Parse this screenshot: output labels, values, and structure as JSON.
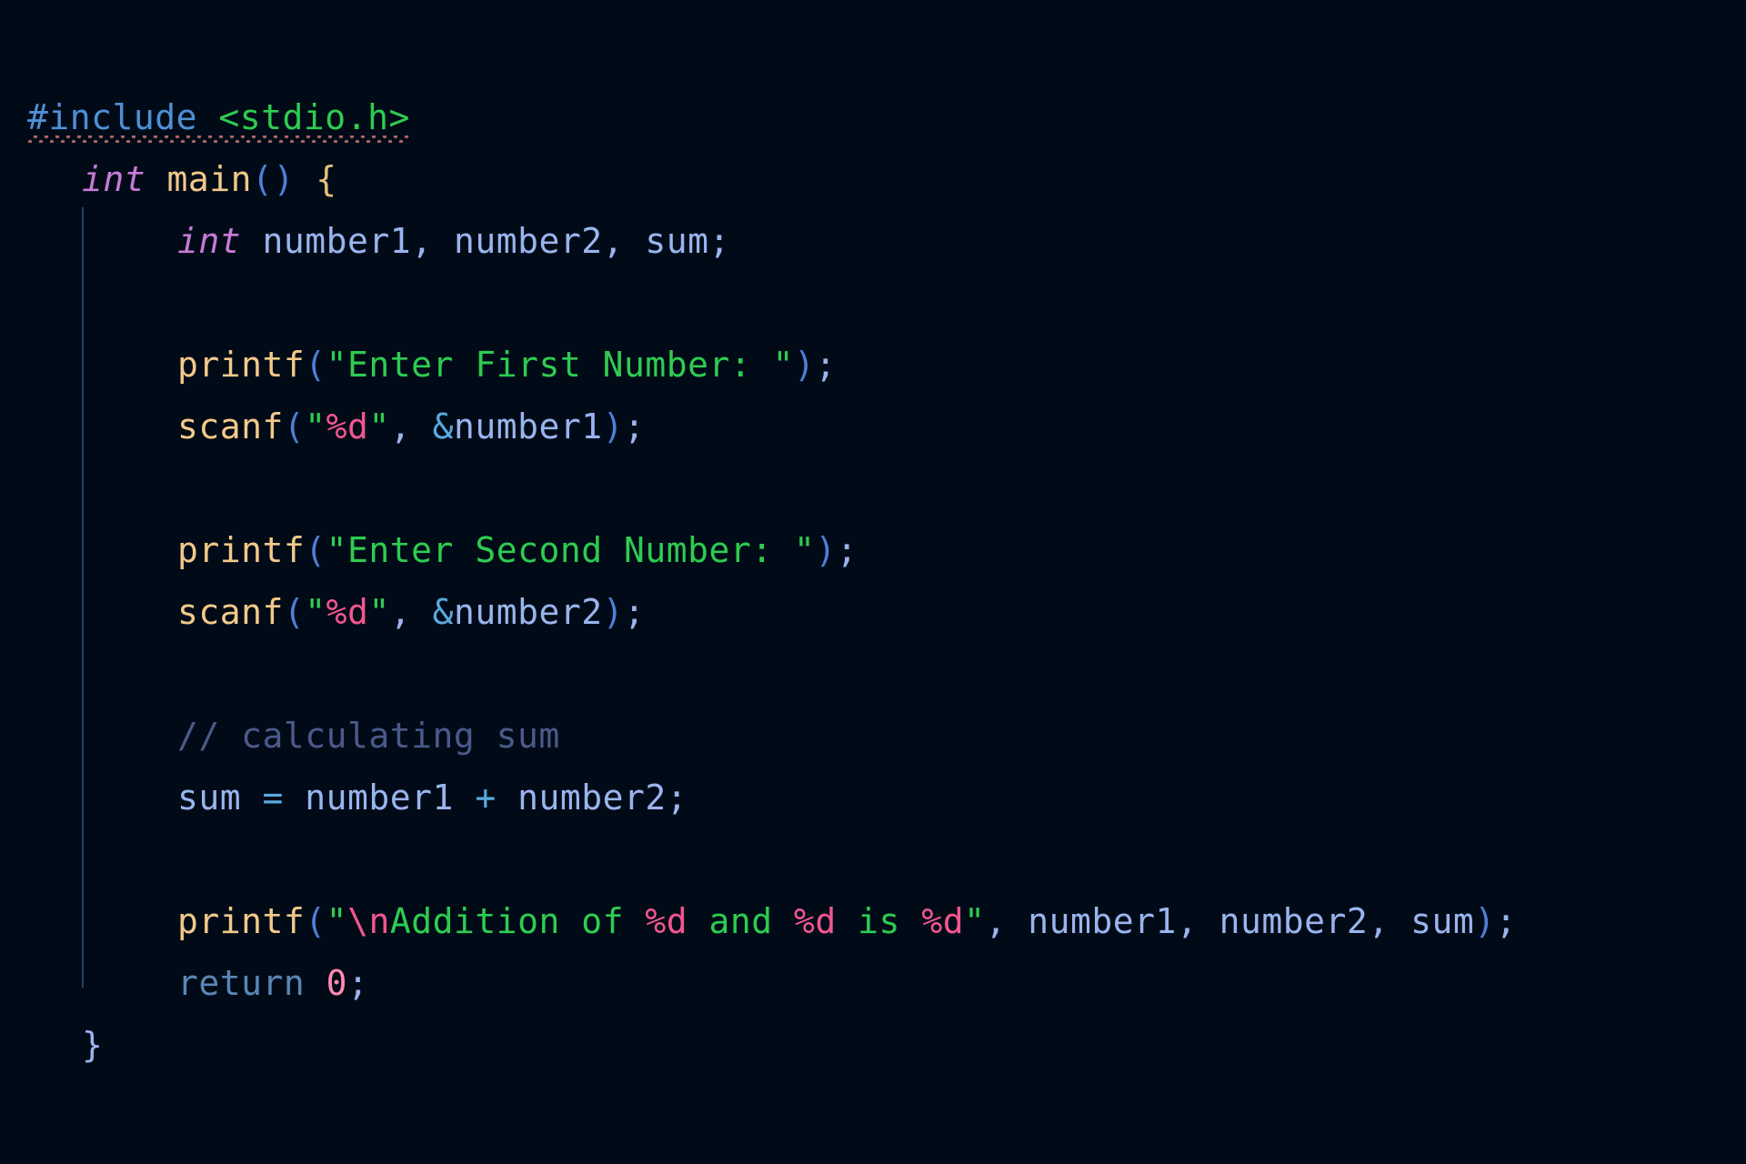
{
  "editor": {
    "language": "c",
    "background_color": "#010b18",
    "font_size_px": 38,
    "indent_guide_color": "#2b4a74",
    "squiggle_color": "#b36a6a"
  },
  "theme_colors": {
    "preprocessor": "#4f8fd6",
    "header_path": "#2ecc50",
    "type_keyword": "#c77ad6",
    "function": "#f2c98a",
    "paren": "#4f7fd6",
    "brace_open": "#e6c07b",
    "brace_close": "#9ab4ee",
    "variable": "#9ab4ee",
    "punctuation": "#9ab4ee",
    "string": "#2ecc50",
    "format_specifier": "#f2568f",
    "comment": "#4a5a8a",
    "operator": "#5aa9e0",
    "keyword": "#5a86b5",
    "number": "#ff8ab0"
  },
  "code": {
    "line1": {
      "preproc": "#include",
      "space": " ",
      "header": "<stdio.h>"
    },
    "line2": {
      "type": "int",
      "space": " ",
      "func": "main",
      "paren_open": "(",
      "paren_close": ")",
      "space2": " ",
      "brace": "{"
    },
    "line3": {
      "type": "int",
      "space": " ",
      "var1": "number1",
      "comma1": ", ",
      "var2": "number2",
      "comma2": ", ",
      "var3": "sum",
      "semi": ";"
    },
    "line5": {
      "func": "printf",
      "paren_open": "(",
      "string": "\"Enter First Number: \"",
      "paren_close": ")",
      "semi": ";"
    },
    "line6": {
      "func": "scanf",
      "paren_open": "(",
      "quote_open": "\"",
      "fmt": "%d",
      "quote_close": "\"",
      "comma": ", ",
      "amp": "&",
      "var": "number1",
      "paren_close": ")",
      "semi": ";"
    },
    "line8": {
      "func": "printf",
      "paren_open": "(",
      "string": "\"Enter Second Number: \"",
      "paren_close": ")",
      "semi": ";"
    },
    "line9": {
      "func": "scanf",
      "paren_open": "(",
      "quote_open": "\"",
      "fmt": "%d",
      "quote_close": "\"",
      "comma": ", ",
      "amp": "&",
      "var": "number2",
      "paren_close": ")",
      "semi": ";"
    },
    "line11": {
      "comment": "// calculating sum"
    },
    "line12": {
      "var_sum": "sum",
      "eq": " = ",
      "var1": "number1",
      "plus": " + ",
      "var2": "number2",
      "semi": ";"
    },
    "line14": {
      "func": "printf",
      "paren_open": "(",
      "quote_open": "\"",
      "esc_n": "\\n",
      "str1": "Addition of ",
      "fmt1": "%d",
      "str2": " and ",
      "fmt2": "%d",
      "str3": " is ",
      "fmt3": "%d",
      "quote_close": "\"",
      "comma1": ", ",
      "arg1": "number1",
      "comma2": ", ",
      "arg2": "number2",
      "comma3": ", ",
      "arg3": "sum",
      "paren_close": ")",
      "semi": ";"
    },
    "line15": {
      "keyword": "return",
      "space": " ",
      "number": "0",
      "semi": ";"
    },
    "line16": {
      "brace_close": "}"
    }
  }
}
